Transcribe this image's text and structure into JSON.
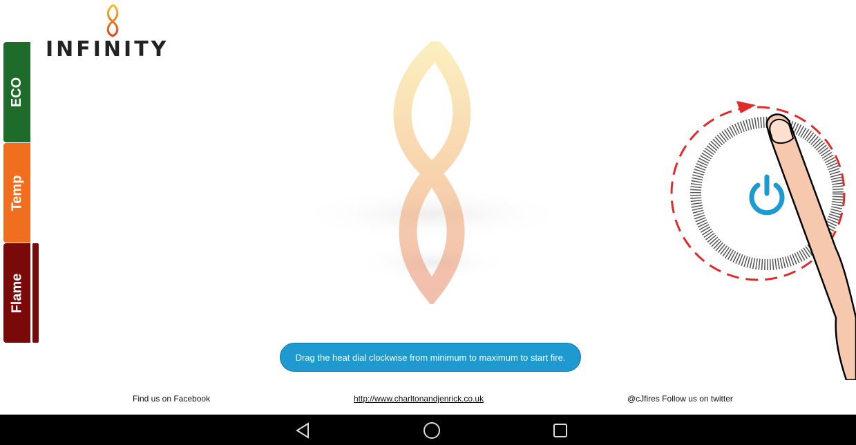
{
  "logo": {
    "text": "INFINITY",
    "icon": "infinity-flame-logo"
  },
  "side_tabs": [
    {
      "label": "ECO",
      "color": "#1e6b2a"
    },
    {
      "label": "Temp",
      "color": "#f06f1e"
    },
    {
      "label": "Flame",
      "color": "#7a0a0a"
    }
  ],
  "dial": {
    "icon": "power-icon",
    "accent": "#1f9ad0",
    "state": "off"
  },
  "hint": "Drag the heat dial clockwise from minimum to maximum to start fire.",
  "footer": {
    "facebook": "Find us on Facebook",
    "website": "http://www.charltonandjenrick.co.uk",
    "twitter": "@cJfires Follow us on twitter"
  },
  "nav": {
    "back_icon": "back-triangle-icon",
    "home_icon": "home-circle-icon",
    "recent_icon": "recent-square-icon"
  }
}
